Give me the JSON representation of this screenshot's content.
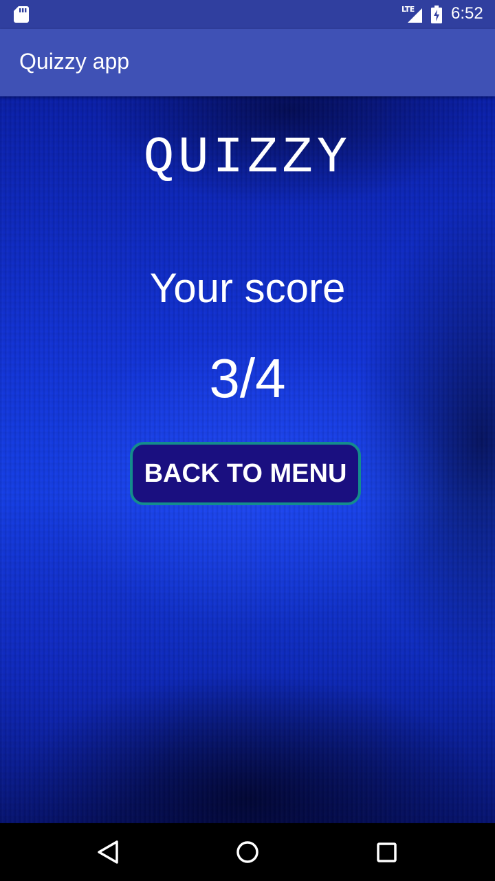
{
  "status_bar": {
    "time": "6:52",
    "network_label": "LTE",
    "icons": [
      "sd-card-icon",
      "lte-signal-icon",
      "battery-charging-icon"
    ]
  },
  "app_bar": {
    "title": "Quizzy app"
  },
  "main": {
    "logo_title": "QUIZZY",
    "score_label": "Your score",
    "score_value": "3/4",
    "back_button_label": "BACK TO MENU"
  },
  "nav_bar": {
    "icons": [
      "back-icon",
      "home-icon",
      "recents-icon"
    ]
  },
  "colors": {
    "status_bar": "#303f9f",
    "app_bar": "#3f51b5",
    "button_fill": "#1a0f80",
    "button_border": "#148c8c",
    "background_blue": "#1540e8"
  }
}
